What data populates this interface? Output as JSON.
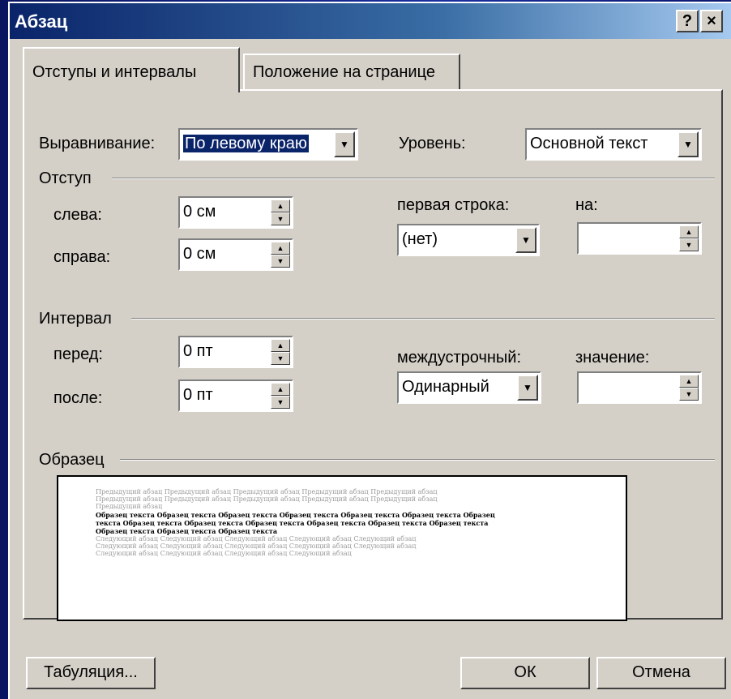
{
  "window": {
    "title": "Абзац",
    "help_label": "?",
    "close_label": "×"
  },
  "tabs": [
    {
      "label": "Отступы и интервалы",
      "active": true
    },
    {
      "label": "Положение на странице",
      "active": false
    }
  ],
  "alignment": {
    "label": "Выравнивание:",
    "value": "По левому краю"
  },
  "level": {
    "label": "Уровень:",
    "value": "Основной текст"
  },
  "indent": {
    "group": "Отступ",
    "left_label": "слева:",
    "left_value": "0 см",
    "right_label": "справа:",
    "right_value": "0 см",
    "first_line_label": "первая строка:",
    "first_line_value": "(нет)",
    "by_label": "на:",
    "by_value": ""
  },
  "spacing": {
    "group": "Интервал",
    "before_label": "перед:",
    "before_value": "0 пт",
    "after_label": "после:",
    "after_value": "0 пт",
    "line_label": "междустрочный:",
    "line_value": "Одинарный",
    "at_label": "значение:",
    "at_value": ""
  },
  "preview": {
    "group": "Образец",
    "prev_lines": [
      "Предыдущий абзац Предыдущий абзац Предыдущий абзац Предыдущий абзац Предыдущий абзац",
      "Предыдущий абзац Предыдущий абзац Предыдущий абзац Предыдущий абзац Предыдущий абзац",
      "Предыдущий абзац"
    ],
    "sample_lines": [
      "Образец текста Образец текста Образец текста Образец текста Образец текста Образец текста Образец",
      "текста Образец текста Образец текста Образец текста Образец текста Образец текста Образец текста",
      "Образец текста Образец текста Образец текста"
    ],
    "next_lines": [
      "Следующий абзац Следующий абзац Следующий абзац Следующий абзац Следующий абзац",
      "Следующий абзац Следующий абзац Следующий абзац Следующий абзац Следующий абзац",
      "Следующий абзац Следующий абзац Следующий абзац Следующий абзац"
    ]
  },
  "buttons": {
    "tabs_label": "Табуляция...",
    "ok_label": "ОК",
    "cancel_label": "Отмена"
  }
}
